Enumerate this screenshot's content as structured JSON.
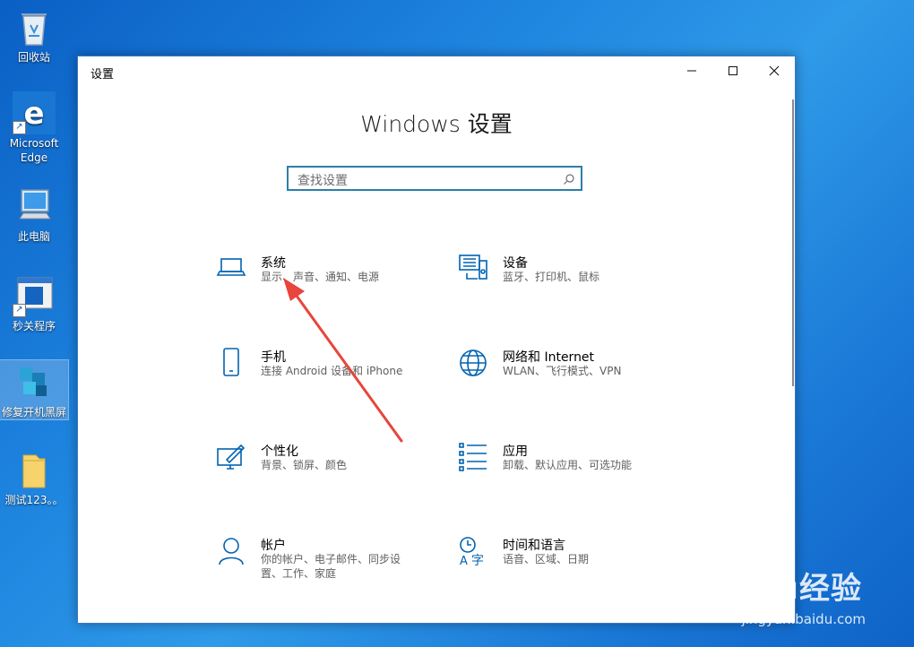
{
  "desktop": {
    "icons": [
      {
        "label": "回收站",
        "icon": "recycle-bin-icon"
      },
      {
        "label": "Microsoft Edge",
        "icon": "edge-icon"
      },
      {
        "label": "此电脑",
        "icon": "computer-icon"
      },
      {
        "label": "秒关程序",
        "icon": "program-shortcut-icon"
      },
      {
        "label": "修复开机黑屏",
        "icon": "repair-tool-icon"
      },
      {
        "label": "测试123。。",
        "icon": "folder-icon"
      }
    ]
  },
  "window": {
    "title": "设置",
    "heading": "Windows 设置",
    "search": {
      "placeholder": "查找设置"
    },
    "categories": [
      {
        "name": "系统",
        "desc": "显示、声音、通知、电源",
        "icon": "laptop-icon"
      },
      {
        "name": "设备",
        "desc": "蓝牙、打印机、鼠标",
        "icon": "keyboard-devices-icon"
      },
      {
        "name": "手机",
        "desc": "连接 Android 设备和 iPhone",
        "icon": "phone-icon"
      },
      {
        "name": "网络和 Internet",
        "desc": "WLAN、飞行模式、VPN",
        "icon": "globe-icon"
      },
      {
        "name": "个性化",
        "desc": "背景、锁屏、颜色",
        "icon": "paint-brush-icon"
      },
      {
        "name": "应用",
        "desc": "卸载、默认应用、可选功能",
        "icon": "apps-list-icon"
      },
      {
        "name": "帐户",
        "desc": "你的帐户、电子邮件、同步设置、工作、家庭",
        "icon": "person-icon"
      },
      {
        "name": "时间和语言",
        "desc": "语音、区域、日期",
        "icon": "time-language-icon"
      }
    ]
  },
  "watermark": {
    "main": "Baidu经验",
    "sub": "jingyan.baidu.com"
  },
  "colors": {
    "accent": "#0063b1",
    "annotation_arrow": "#e8453c"
  }
}
